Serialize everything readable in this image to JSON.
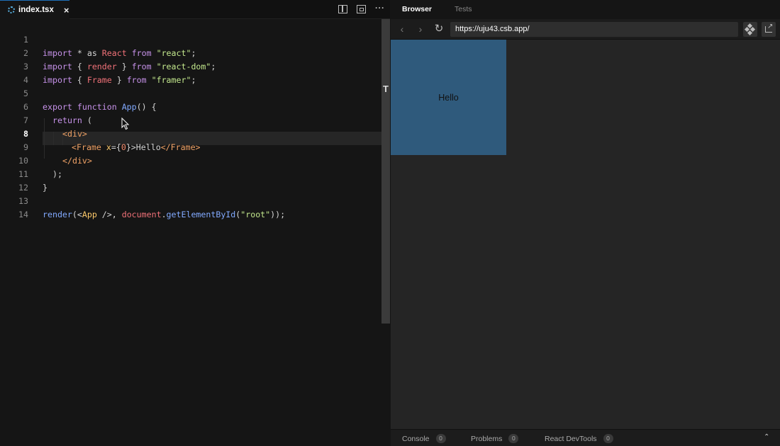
{
  "editor": {
    "tab": {
      "filename": "index.tsx",
      "icon": "gear-icon",
      "close_glyph": "×"
    },
    "toolbar": {
      "split_icon": "split-view-icon",
      "preview_icon": "preview-icon",
      "more_glyph": "···"
    },
    "line_numbers": [
      "1",
      "2",
      "3",
      "4",
      "5",
      "6",
      "7",
      "8",
      "9",
      "10",
      "11",
      "12",
      "13",
      "14"
    ],
    "active_line": "8",
    "code": {
      "l1": {
        "a": "import",
        "b": " * ",
        "c": "as",
        "d": " React ",
        "e": "from",
        "f": " \"react\"",
        "g": ";"
      },
      "l2": {
        "a": "import",
        "b": " { ",
        "c": "render",
        "d": " } ",
        "e": "from",
        "f": " \"react-dom\"",
        "g": ";"
      },
      "l3": {
        "a": "import",
        "b": " { ",
        "c": "Frame",
        "d": " } ",
        "e": "from",
        "f": " \"framer\"",
        "g": ";"
      },
      "l5": {
        "a": "export",
        "b": " function",
        "c": " App",
        "d": "() {"
      },
      "l6": {
        "a": "return",
        "b": " ("
      },
      "l7": {
        "a": "<div>"
      },
      "l8": {
        "a": "<Frame",
        "b": " x",
        "c": "={",
        "d": "0",
        "e": "}",
        "f": ">Hello",
        "g": "</Frame>"
      },
      "l9": {
        "a": "</div>"
      },
      "l10": {
        "a": ");"
      },
      "l11": {
        "a": "}"
      },
      "l13": {
        "a": "render",
        "b": "(<",
        "c": "App",
        "d": " />, ",
        "e": "document",
        "f": ".",
        "g": "getElementById",
        "h": "(",
        "i": "\"root\"",
        "j": "));"
      }
    }
  },
  "browser": {
    "tabs": {
      "browser": "Browser",
      "tests": "Tests"
    },
    "nav": {
      "back": "‹",
      "forward": "›",
      "refresh": "↻"
    },
    "url": "https://uju43.csb.app/",
    "preview": {
      "frame_text": "Hello",
      "frame_color": "#2f5a7c"
    },
    "devtools": {
      "console": "Console",
      "console_count": "0",
      "problems": "Problems",
      "problems_count": "0",
      "react": "React DevTools",
      "react_count": "0",
      "toggle": "⌃"
    }
  },
  "colors": {
    "accent": "#1e6fb8",
    "background": "#151515"
  }
}
